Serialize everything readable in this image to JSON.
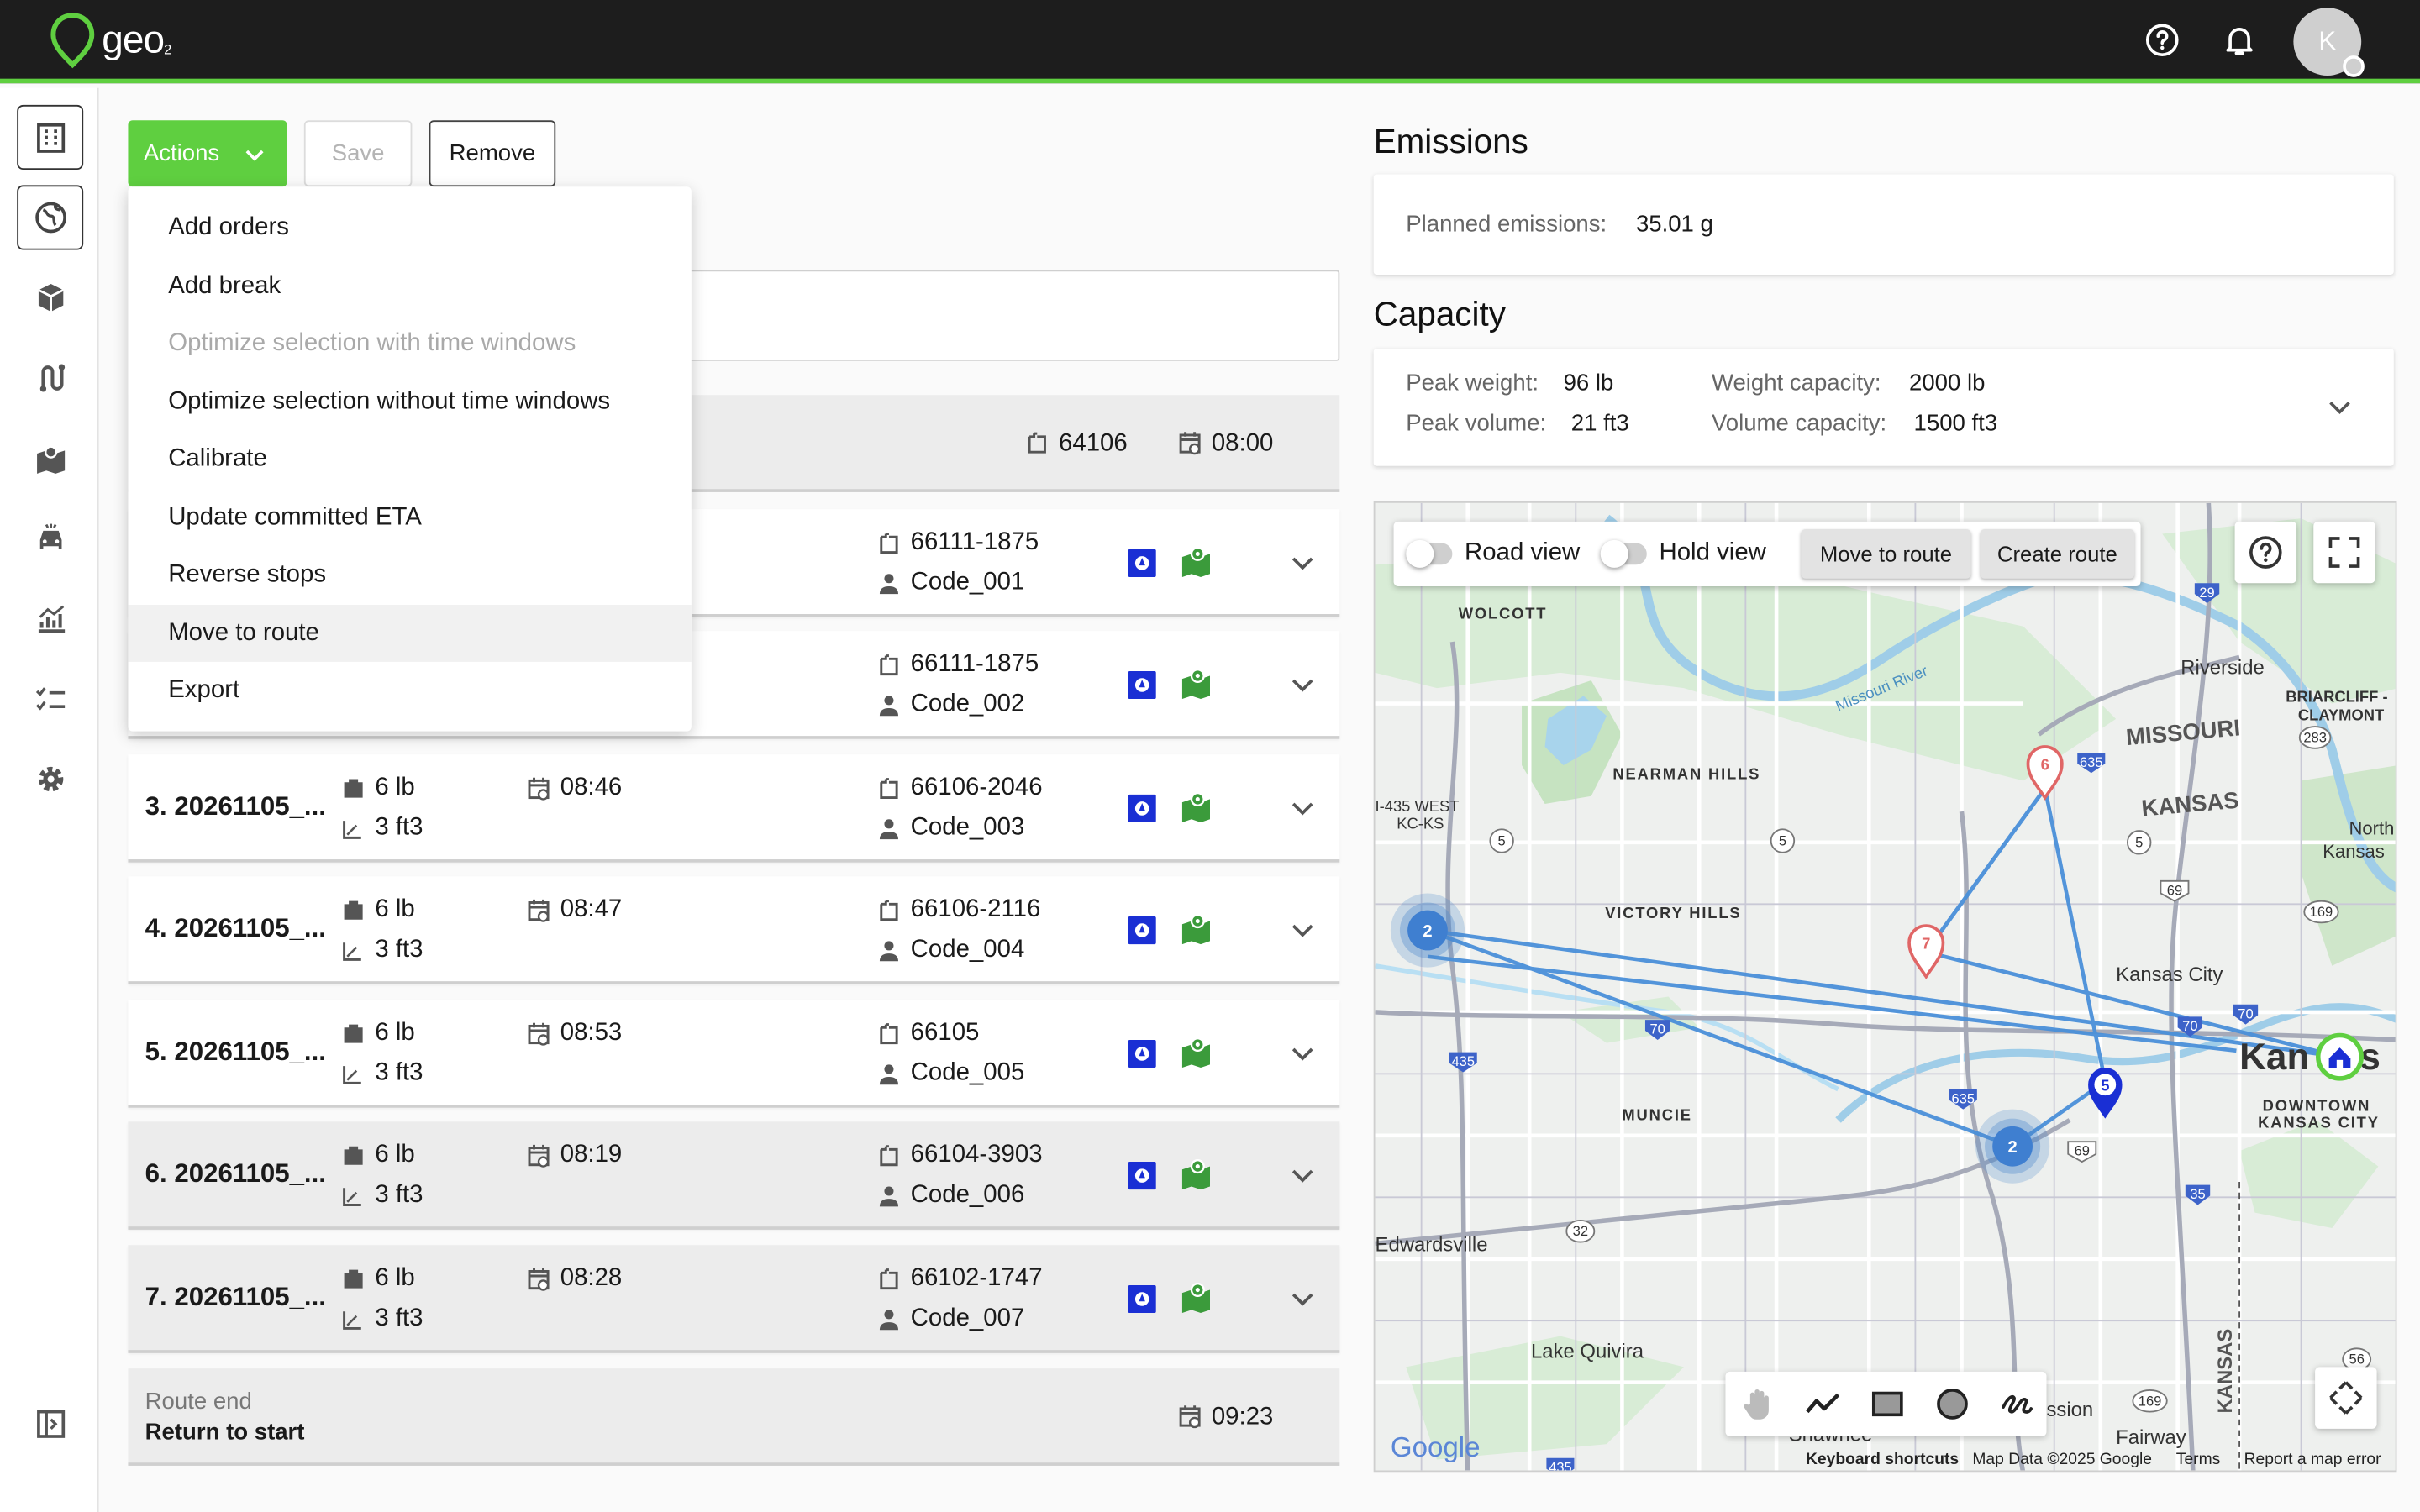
{
  "app": {
    "logo_text": "geo",
    "logo_sub": "2",
    "avatar_initial": "K"
  },
  "toolbar": {
    "actions_label": "Actions",
    "save_label": "Save",
    "remove_label": "Remove"
  },
  "actions_menu": [
    {
      "label": "Add orders",
      "state": "enabled"
    },
    {
      "label": "Add break",
      "state": "enabled"
    },
    {
      "label": "Optimize selection with time windows",
      "state": "disabled"
    },
    {
      "label": "Optimize selection without time windows",
      "state": "enabled"
    },
    {
      "label": "Calibrate",
      "state": "enabled"
    },
    {
      "label": "Update committed ETA",
      "state": "enabled"
    },
    {
      "label": "Reverse stops",
      "state": "enabled"
    },
    {
      "label": "Move to route",
      "state": "hover"
    },
    {
      "label": "Export",
      "state": "enabled"
    }
  ],
  "route_start": {
    "zip": "64106",
    "time": "08:00"
  },
  "stops": [
    {
      "zip": "66111-1875",
      "code": "Code_001"
    },
    {
      "zip": "66111-1875",
      "code": "Code_002"
    },
    {
      "title": "3. 20261105_...",
      "weight": "6 lb",
      "volume": "3 ft3",
      "time": "08:46",
      "zip": "66106-2046",
      "code": "Code_003"
    },
    {
      "title": "4. 20261105_...",
      "weight": "6 lb",
      "volume": "3 ft3",
      "time": "08:47",
      "zip": "66106-2116",
      "code": "Code_004"
    },
    {
      "title": "5. 20261105_...",
      "weight": "6 lb",
      "volume": "3 ft3",
      "time": "08:53",
      "zip": "66105",
      "code": "Code_005"
    },
    {
      "title": "6. 20261105_...",
      "weight": "6 lb",
      "volume": "3 ft3",
      "time": "08:19",
      "zip": "66104-3903",
      "code": "Code_006"
    },
    {
      "title": "7. 20261105_...",
      "weight": "6 lb",
      "volume": "3 ft3",
      "time": "08:28",
      "zip": "66102-1747",
      "code": "Code_007"
    }
  ],
  "route_end": {
    "label": "Route end",
    "subtitle": "Return to start",
    "time": "09:23"
  },
  "emissions": {
    "title": "Emissions",
    "label": "Planned emissions:",
    "value": "35.01 g"
  },
  "capacity": {
    "title": "Capacity",
    "peak_weight_label": "Peak weight:",
    "peak_weight": "96 lb",
    "peak_volume_label": "Peak volume:",
    "peak_volume": "21 ft3",
    "weight_capacity_label": "Weight capacity:",
    "weight_capacity": "2000 lb",
    "volume_capacity_label": "Volume capacity:",
    "volume_capacity": "1500 ft3"
  },
  "map": {
    "road_view_label": "Road view",
    "hold_view_label": "Hold view",
    "move_to_route_label": "Move to route",
    "create_route_label": "Create route",
    "places": {
      "wolcott": "WOLCOTT",
      "riverside": "Riverside",
      "briarcliff": "BRIARCLIFF -",
      "claymont": "CLAYMONT",
      "missouri": "MISSOURI",
      "kansas": "KANSAS",
      "north": "North",
      "kansas2": "Kansas",
      "nearman": "NEARMAN HILLS",
      "i435": "I-435 WEST",
      "kcks": "KC-KS",
      "victory": "VICTORY HILLS",
      "kansas_city": "Kansas City",
      "kan": "Kan",
      "s": "s",
      "downtown": "DOWNTOWN",
      "kcity": "KANSAS CITY",
      "muncie": "MUNCIE",
      "edwardsville": "Edwardsville",
      "lake_quivira": "Lake Quivira",
      "kansas_vert": "KANSAS",
      "shawnee": "Shawnee",
      "ssion": "ssion",
      "fairway": "Fairway",
      "missouri_river": "Missouri River"
    },
    "shields": [
      "29",
      "283",
      "635",
      "5",
      "5",
      "5",
      "69",
      "169",
      "70",
      "70",
      "435",
      "70",
      "635",
      "69",
      "35",
      "32",
      "56",
      "169",
      "435"
    ],
    "markers": [
      {
        "label": "6",
        "color": "#e06666"
      },
      {
        "label": "7",
        "color": "#e06666"
      },
      {
        "label": "5",
        "color": "#1a2fd4"
      },
      {
        "label": "2",
        "color": "#4a86cc"
      },
      {
        "label": "2",
        "color": "#4a86cc"
      }
    ],
    "route_color": "#4a90d9",
    "google_label": "Google",
    "attribution": {
      "shortcuts": "Keyboard shortcuts",
      "data": "Map Data ©2025 Google",
      "terms": "Terms",
      "report": "Report a map error"
    }
  },
  "icons": {
    "help": "help-circle-icon",
    "bell": "bell-icon",
    "building": "building-icon",
    "globe": "globe-icon",
    "box": "box-icon",
    "route": "route-icon",
    "map": "map-icon",
    "car": "car-icon",
    "chart": "chart-icon",
    "checklist": "checklist-icon",
    "gear": "gear-icon",
    "collapse": "sidebar-collapse-icon"
  },
  "colors": {
    "brand_green": "#5fcf40",
    "topbar": "#1d1d1d",
    "navi_blue": "#1a2fd4",
    "map_green": "#3b9b3b"
  }
}
